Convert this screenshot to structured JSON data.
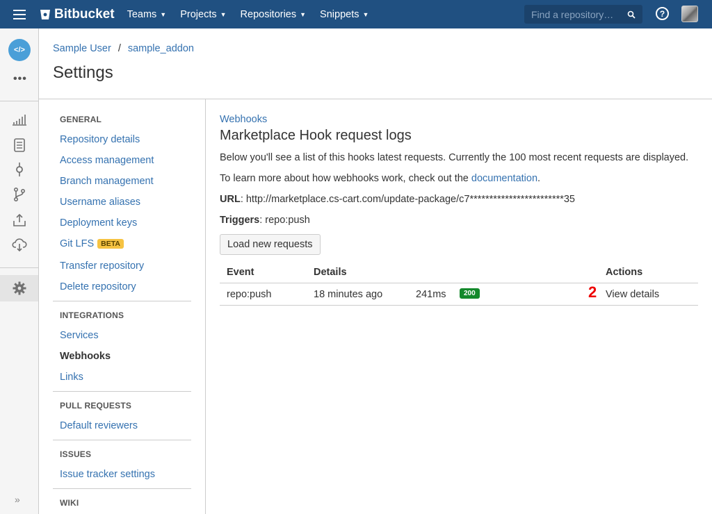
{
  "topbar": {
    "brand": "Bitbucket",
    "nav": [
      {
        "label": "Teams"
      },
      {
        "label": "Projects"
      },
      {
        "label": "Repositories"
      },
      {
        "label": "Snippets"
      }
    ],
    "search_placeholder": "Find a repository…"
  },
  "rail": {
    "repo_avatar": "</>"
  },
  "breadcrumb": {
    "owner": "Sample User",
    "separator": "/",
    "repo": "sample_addon"
  },
  "page_title": "Settings",
  "settings_nav": {
    "general": {
      "heading": "GENERAL",
      "items": [
        "Repository details",
        "Access management",
        "Branch management",
        "Username aliases",
        "Deployment keys",
        "Git LFS",
        "Transfer repository",
        "Delete repository"
      ],
      "beta_badge": "BETA"
    },
    "integrations": {
      "heading": "INTEGRATIONS",
      "items": [
        "Services",
        "Webhooks",
        "Links"
      ]
    },
    "pull_requests": {
      "heading": "PULL REQUESTS",
      "items": [
        "Default reviewers"
      ]
    },
    "issues": {
      "heading": "ISSUES",
      "items": [
        "Issue tracker settings"
      ]
    },
    "wiki": {
      "heading": "WIKI"
    }
  },
  "main": {
    "breadcrumb": "Webhooks",
    "title": "Marketplace Hook request logs",
    "intro": "Below you'll see a list of this hooks latest requests. Currently the 100 most recent requests are displayed.",
    "learn_prefix": "To learn more about how webhooks work, check out the ",
    "learn_link": "documentation",
    "learn_suffix": ".",
    "url_label": "URL",
    "url_value": ": http://marketplace.cs-cart.com/update-package/c7************************35",
    "triggers_label": "Triggers",
    "triggers_value": ": repo:push",
    "load_button": "Load new requests",
    "table": {
      "headers": {
        "event": "Event",
        "details": "Details",
        "actions": "Actions"
      },
      "rows": [
        {
          "event": "repo:push",
          "time": "18 minutes ago",
          "duration": "241ms",
          "status": "200",
          "marker": "2",
          "action": "View details"
        }
      ]
    }
  },
  "colors": {
    "topbar": "#205081",
    "link": "#3572b0",
    "status_ok": "#14892c",
    "beta": "#f6c342"
  }
}
